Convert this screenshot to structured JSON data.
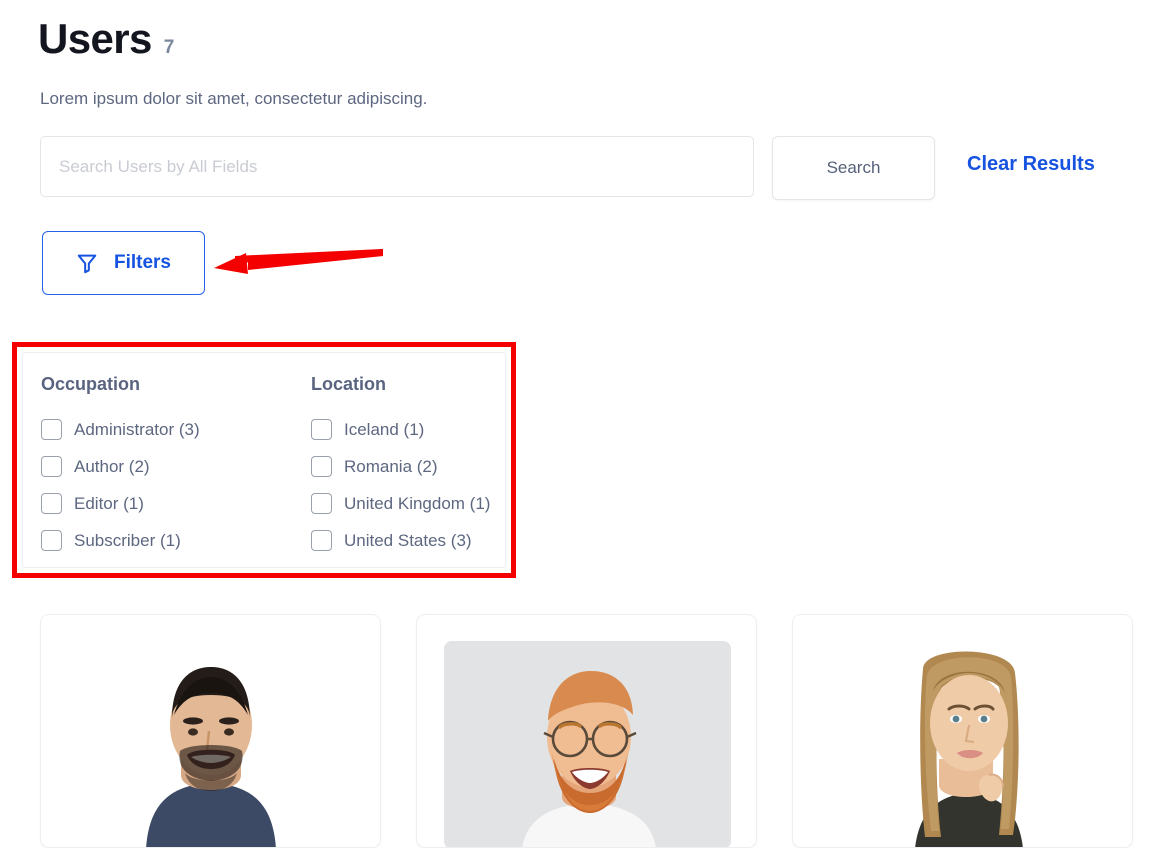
{
  "header": {
    "title": "Users",
    "count": "7",
    "subtitle": "Lorem ipsum dolor sit amet, consectetur adipiscing."
  },
  "search": {
    "placeholder": "Search Users by All Fields",
    "value": "",
    "search_label": "Search",
    "clear_label": "Clear Results"
  },
  "filters_button": {
    "label": "Filters",
    "icon": "funnel-icon",
    "accent_color": "#1553e0"
  },
  "annotation": {
    "arrow_color": "#f50000",
    "box_color": "#f50000",
    "arrow_points_to": "Filters"
  },
  "filter_panel": {
    "groups": [
      {
        "title": "Occupation",
        "options": [
          {
            "label": "Administrator (3)",
            "checked": false
          },
          {
            "label": "Author (2)",
            "checked": false
          },
          {
            "label": "Editor (1)",
            "checked": false
          },
          {
            "label": "Subscriber (1)",
            "checked": false
          }
        ]
      },
      {
        "title": "Location",
        "options": [
          {
            "label": "Iceland (1)",
            "checked": false
          },
          {
            "label": "Romania (2)",
            "checked": false
          },
          {
            "label": "United Kingdom (1)",
            "checked": false
          },
          {
            "label": "United States (3)",
            "checked": false
          }
        ]
      }
    ]
  },
  "cards": [
    {
      "photo_alt": "man-with-dark-hair-and-beard-in-navy-shirt",
      "background": "#ffffff",
      "inset": false
    },
    {
      "photo_alt": "smiling-man-with-red-beard-and-glasses-in-white-shirt",
      "background": "#e2e3e5",
      "inset": true
    },
    {
      "photo_alt": "young-woman-with-long-light-brown-hair-in-dark-patterned-top",
      "background": "#ffffff",
      "inset": false
    }
  ]
}
